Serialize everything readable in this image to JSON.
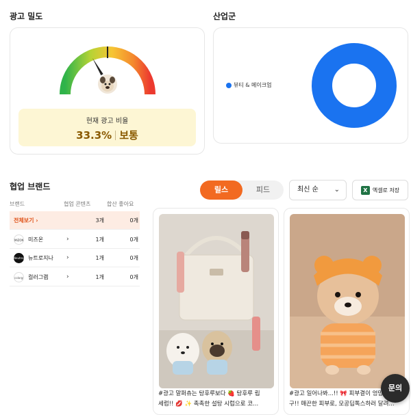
{
  "ad_density": {
    "title": "광고 밀도",
    "ratio_label": "현재 광고 비율",
    "ratio_percent": "33.3%",
    "ratio_level": "보통",
    "gauge_value": 0.333
  },
  "industry": {
    "title": "산업군",
    "legend": [
      {
        "label": "뷰티 & 메이크업",
        "color": "#1a73f0"
      }
    ],
    "chart_data": {
      "type": "pie",
      "categories": [
        "뷰티 & 메이크업"
      ],
      "values": [
        100
      ]
    }
  },
  "brands": {
    "title": "협업 브랜드",
    "headers": {
      "brand": "브랜드",
      "content": "협업 콘텐츠",
      "likes": "합산 좋아요"
    },
    "all": {
      "label": "전체보기",
      "count": "3개",
      "likes": "0개"
    },
    "rows": [
      {
        "name": "미즈온",
        "logo": "MIZON",
        "count": "1개",
        "likes": "0개"
      },
      {
        "name": "뉴트로지나",
        "logo": "Neutrogena",
        "count": "1개",
        "likes": "0개"
      },
      {
        "name": "컬러그램",
        "logo": "colorgram",
        "count": "1개",
        "likes": "0개"
      }
    ]
  },
  "tabs": {
    "reels": "릴스",
    "feed": "피드"
  },
  "sort": {
    "selected": "최신 순"
  },
  "excel": {
    "label": "엑셀로 저장"
  },
  "posts": [
    {
      "caption_line1": "#광고 말퍼츄는 탕후루보다 🍓 탕후루 립",
      "caption_line2": "세럼!! 💋 ✨ 촉촉한 설탕 시럽으로 코..."
    },
    {
      "caption_line1": "#광고 일어나봐...!! 🎀 피부결이 엉망",
      "caption_line2": "구!! 매끈한 피부로, 모공딥톡스하러 달려..."
    }
  ],
  "fab": {
    "label": "문의"
  },
  "colors": {
    "accent": "#f26a21",
    "donut": "#1a73f0",
    "highlight_bg": "#fdf6d4"
  }
}
